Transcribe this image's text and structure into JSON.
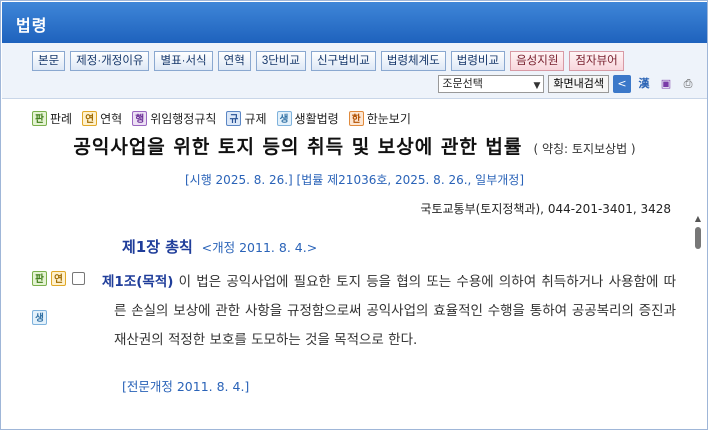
{
  "app": {
    "title": "법령"
  },
  "toolbar": {
    "buttons": [
      "본문",
      "제정·개정이유",
      "별표·서식",
      "연혁",
      "3단비교",
      "신구법비교",
      "법령체계도",
      "법령비교"
    ],
    "pink_buttons": [
      "음성지원",
      "점자뷰어"
    ],
    "select_value": "조문선택",
    "search_label": "화면내검색",
    "icons": [
      "share-icon",
      "hanja-icon",
      "save-icon",
      "print-icon"
    ]
  },
  "legend": {
    "items": [
      {
        "badge": "판",
        "label": "판례",
        "color": "#7bb04d"
      },
      {
        "badge": "연",
        "label": "연혁",
        "color": "#e0a828"
      },
      {
        "badge": "행",
        "label": "위임행정규칙",
        "color": "#9a66c0"
      },
      {
        "badge": "규",
        "label": "규제",
        "color": "#5b86c4"
      },
      {
        "badge": "생",
        "label": "생활법령",
        "color": "#7fb2dc"
      },
      {
        "badge": "한",
        "label": "한눈보기",
        "color": "#e08a3c"
      }
    ]
  },
  "law": {
    "title": "공익사업을 위한 토지 등의 취득 및 보상에 관한 법률",
    "abbreviation": "( 약칭: 토지보상법 )",
    "enforcement": "[시행 2025. 8. 26.] [법률 제21036호, 2025. 8. 26., 일부개정]",
    "ministry": "국토교통부(토지정책과), 044-201-3401, 3428"
  },
  "chapter": {
    "title": "제1장 총칙",
    "note": "<개정 2011. 8. 4.>"
  },
  "article": {
    "badges": [
      "판",
      "연",
      "생"
    ],
    "title": "제1조(목적)",
    "body": "이 법은 공익사업에 필요한 토지 등을 협의 또는 수용에 의하여 취득하거나 사용함에 따른 손실의 보상에 관한 사항을 규정함으로써 공익사업의 효율적인 수행을 통하여 공공복리의 증진과 재산권의 적정한 보호를 도모하는 것을 목적으로 한다.",
    "revised": "[전문개정 2011. 8. 4.]"
  }
}
